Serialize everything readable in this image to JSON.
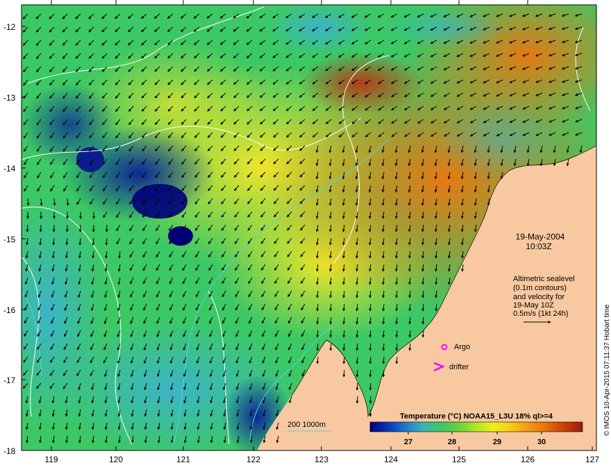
{
  "map": {
    "date": "19-May-2004",
    "time": "10:03Z",
    "legend": {
      "line1": "Altimetric sealevel",
      "line2": "(0.1m contours)",
      "line3": "and velocity for",
      "line4": "19-May 10Z",
      "line5": "0.5m/s (1kt 24h)"
    },
    "markers": {
      "argo": "Argo",
      "drifter": "drifter"
    },
    "bathymetry_label": "200  1000m",
    "colorbar": {
      "title": "Temperature (°C) NOAA15_L3U 18% ql>=4",
      "ticks": [
        "27",
        "28",
        "29",
        "30"
      ],
      "ramp": [
        "#00007a",
        "#0a35b4",
        "#1e78d2",
        "#3cb4b4",
        "#3cc864",
        "#64d23c",
        "#b4e628",
        "#f0f01e",
        "#f5c814",
        "#f09614",
        "#e66e0a",
        "#c83c0a",
        "#961e0a"
      ]
    },
    "credit": "© IMOS 10-Apr-2015 07:11:37 Hobart time",
    "y_axis": [
      "-12",
      "-13",
      "-14",
      "-15",
      "-16",
      "-17",
      "-18"
    ],
    "x_axis": [
      "119",
      "120",
      "121",
      "122",
      "123",
      "124",
      "125",
      "126",
      "127"
    ],
    "colors": {
      "land": "#f8c9a0",
      "arrow": "#000000",
      "contour": "#ffffff",
      "isobath": "#50d2e6",
      "marker": "#ff00ff"
    }
  }
}
